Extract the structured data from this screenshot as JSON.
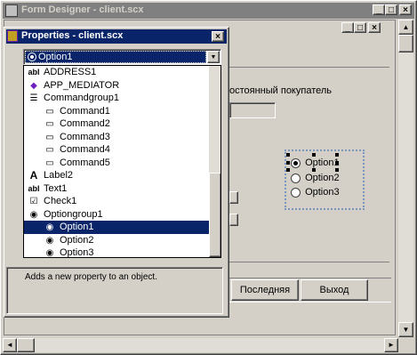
{
  "designer": {
    "title": "Form Designer - client.scx",
    "window_buttons": [
      "_",
      "□",
      "×"
    ],
    "inner_buttons": [
      "_",
      "□",
      "×"
    ]
  },
  "form": {
    "label_text": "остоянный покупатель",
    "optiongroup": [
      "Option1",
      "Option2",
      "Option3"
    ],
    "buttons": [
      "Последняя",
      "Выход"
    ]
  },
  "properties": {
    "title": "Properties - client.scx",
    "close": "×",
    "dropdown_value": "Option1",
    "dropdown_arrow": "▼",
    "items": [
      {
        "label": "ADDRESS1",
        "icon": "textbox-icon",
        "glyph": "abl",
        "indent": 0
      },
      {
        "label": "APP_MEDIATOR",
        "icon": "custom-object-icon",
        "glyph": "◆",
        "indent": 0
      },
      {
        "label": "Commandgroup1",
        "icon": "commandgroup-icon",
        "glyph": "☰",
        "indent": 0
      },
      {
        "label": "Command1",
        "icon": "command-button-icon",
        "glyph": "▭",
        "indent": 1
      },
      {
        "label": "Command2",
        "icon": "command-button-icon",
        "glyph": "▭",
        "indent": 1
      },
      {
        "label": "Command3",
        "icon": "command-button-icon",
        "glyph": "▭",
        "indent": 1
      },
      {
        "label": "Command4",
        "icon": "command-button-icon",
        "glyph": "▭",
        "indent": 1
      },
      {
        "label": "Command5",
        "icon": "command-button-icon",
        "glyph": "▭",
        "indent": 1
      },
      {
        "label": "Label2",
        "icon": "label-icon",
        "glyph": "A",
        "indent": 0
      },
      {
        "label": "Text1",
        "icon": "textbox-icon",
        "glyph": "abl",
        "indent": 0
      },
      {
        "label": "Check1",
        "icon": "checkbox-icon",
        "glyph": "☑",
        "indent": 0
      },
      {
        "label": "Optiongroup1",
        "icon": "optiongroup-icon",
        "glyph": "◉",
        "indent": 0
      },
      {
        "label": "Option1",
        "icon": "option-button-icon",
        "glyph": "◉",
        "indent": 1,
        "selected": true
      },
      {
        "label": "Option2",
        "icon": "option-button-icon",
        "glyph": "◉",
        "indent": 1
      },
      {
        "label": "Option3",
        "icon": "option-button-icon",
        "glyph": "◉",
        "indent": 1
      }
    ],
    "description": "Adds a new property to an object."
  },
  "scroll": {
    "up": "▲",
    "down": "▼",
    "left": "◄",
    "right": "►"
  },
  "colors": {
    "title_active": "#0a246a",
    "title_inactive": "#808080",
    "face": "#d4d0c8"
  }
}
